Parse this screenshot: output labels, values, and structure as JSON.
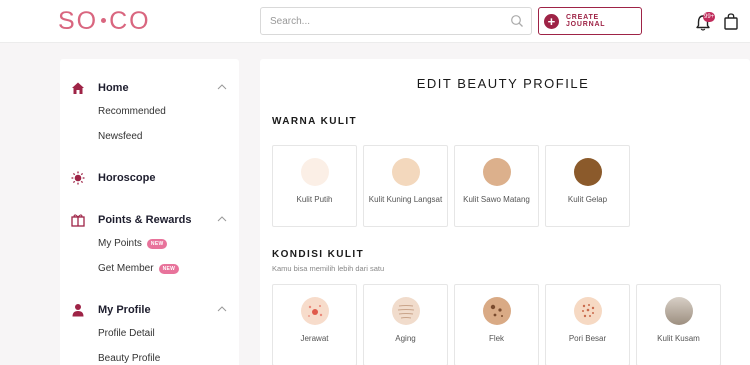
{
  "header": {
    "logo": "SO·CO",
    "search_placeholder": "Search...",
    "create_label": "CREATE JOURNAL",
    "notif_count": "99+"
  },
  "sidebar": {
    "sections": [
      {
        "label": "Home",
        "icon": "home-icon",
        "items": [
          "Recommended",
          "Newsfeed"
        ]
      },
      {
        "label": "Horoscope",
        "icon": "sun-icon",
        "items": []
      },
      {
        "label": "Points & Rewards",
        "icon": "gift-icon",
        "items": [
          "My Points",
          "Get Member"
        ],
        "tag": "NEW"
      },
      {
        "label": "My Profile",
        "icon": "user-icon",
        "items": [
          "Profile Detail",
          "Beauty Profile"
        ]
      }
    ]
  },
  "main": {
    "title": "EDIT BEAUTY PROFILE",
    "skin_tone": {
      "title": "WARNA KULIT",
      "options": [
        {
          "label": "Kulit Putih",
          "color": "#fbefe6"
        },
        {
          "label": "Kulit Kuning Langsat",
          "color": "#f3d8bd"
        },
        {
          "label": "Kulit Sawo Matang",
          "color": "#dcb08c"
        },
        {
          "label": "Kulit Gelap",
          "color": "#8b5a2b"
        }
      ]
    },
    "skin_condition": {
      "title": "KONDISI KULIT",
      "subtitle": "Kamu bisa memilih lebih dari satu",
      "options": [
        {
          "label": "Jerawat",
          "icon": "acne-icon"
        },
        {
          "label": "Aging",
          "icon": "wrinkle-icon"
        },
        {
          "label": "Flek",
          "icon": "spots-icon"
        },
        {
          "label": "Pori Besar",
          "icon": "pores-icon"
        },
        {
          "label": "Kulit Kusam",
          "icon": "dull-skin-icon"
        }
      ]
    }
  },
  "colors": {
    "brand": "#9e2346",
    "logo": "#d9667f",
    "tag": "#e8739b"
  }
}
